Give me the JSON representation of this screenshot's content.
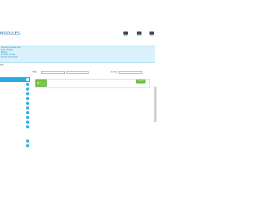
{
  "page": {
    "title": "MODULES"
  },
  "header_buttons": [
    {
      "label": "Add",
      "icon": "add-icon"
    },
    {
      "label": "Check",
      "icon": "check-icon"
    },
    {
      "label": "Help",
      "icon": "help-icon"
    }
  ],
  "info_lines": [
    "Trending modules here",
    "Shop modules",
    "Ratings",
    "Modules for sale",
    "Browse all modules"
  ],
  "section_label": "Lst",
  "sidebar": {
    "items": [
      {
        "label": "",
        "count": "1",
        "active": true
      },
      {
        "label": "",
        "count": "1",
        "active": false
      },
      {
        "label": "",
        "count": "1",
        "active": false
      },
      {
        "label": "",
        "count": "1",
        "active": false
      },
      {
        "label": "",
        "count": "1",
        "active": false
      },
      {
        "label": "",
        "count": "1",
        "active": false
      },
      {
        "label": "",
        "count": "1",
        "active": false
      },
      {
        "label": "",
        "count": "1",
        "active": false
      },
      {
        "label": "",
        "count": "1",
        "active": false
      },
      {
        "label": "",
        "count": "1",
        "active": false
      },
      {
        "label": "",
        "count": "1",
        "active": false
      },
      {
        "label": "",
        "count": "1",
        "active": false
      },
      {
        "label": "",
        "count": "1",
        "active": false
      }
    ]
  },
  "filters": {
    "filter_label": "Filter",
    "filter1": "",
    "filter2": "",
    "sort_label": "Sort by",
    "sort_value": ""
  },
  "module": {
    "name": "",
    "description": "",
    "install_label": "Install"
  },
  "colors": {
    "accent": "#27a9e1",
    "info_bg": "#d9f2fb",
    "install_green": "#6ebf3e"
  }
}
